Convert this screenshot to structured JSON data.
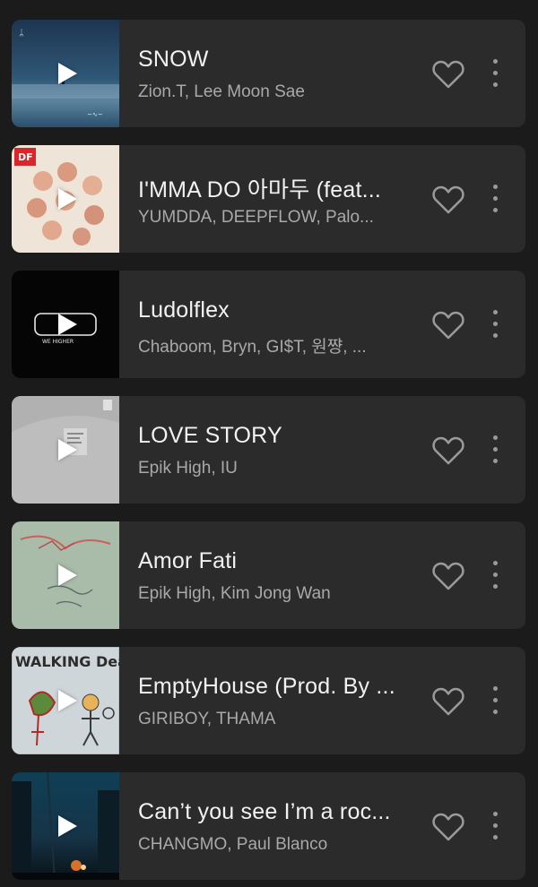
{
  "songs": [
    {
      "title": "SNOW",
      "artists": "Zion.T, Lee Moon Sae",
      "art_icon": "album-art-snow"
    },
    {
      "title": "I'MMA DO 아마두 (feat...",
      "artists": "YUMDDA, DEEPFLOW, Palo...",
      "art_icon": "album-art-group-photo",
      "art_badge": "DF"
    },
    {
      "title": "Ludolflex",
      "artists": "Chaboom, Bryn, GI$T, 원쨩, ...",
      "art_icon": "album-art-we-higher",
      "art_text": "WE HIGHER"
    },
    {
      "title": "LOVE STORY",
      "artists": "Epik High, IU",
      "art_icon": "album-art-grey-paper"
    },
    {
      "title": "Amor Fati",
      "artists": "Epik High, Kim Jong Wan",
      "art_icon": "album-art-illustration"
    },
    {
      "title": "EmptyHouse (Prod. By ...",
      "artists": "GIRIBOY, THAMA",
      "art_icon": "album-art-walking-dead",
      "art_text": "WALKING Dead"
    },
    {
      "title": "Can’t you see I’m a roc...",
      "artists": "CHANGMO, Paul Blanco",
      "art_icon": "album-art-night-street"
    }
  ],
  "colors": {
    "background": "#1b1b1b",
    "card": "#2b2b2b",
    "title": "#f2f2f2",
    "subtitle": "#a9a9a9",
    "icon": "#9a9a9a"
  },
  "icons": {
    "play": "play-icon",
    "favorite": "heart-outline-icon",
    "more": "more-vertical-icon"
  }
}
